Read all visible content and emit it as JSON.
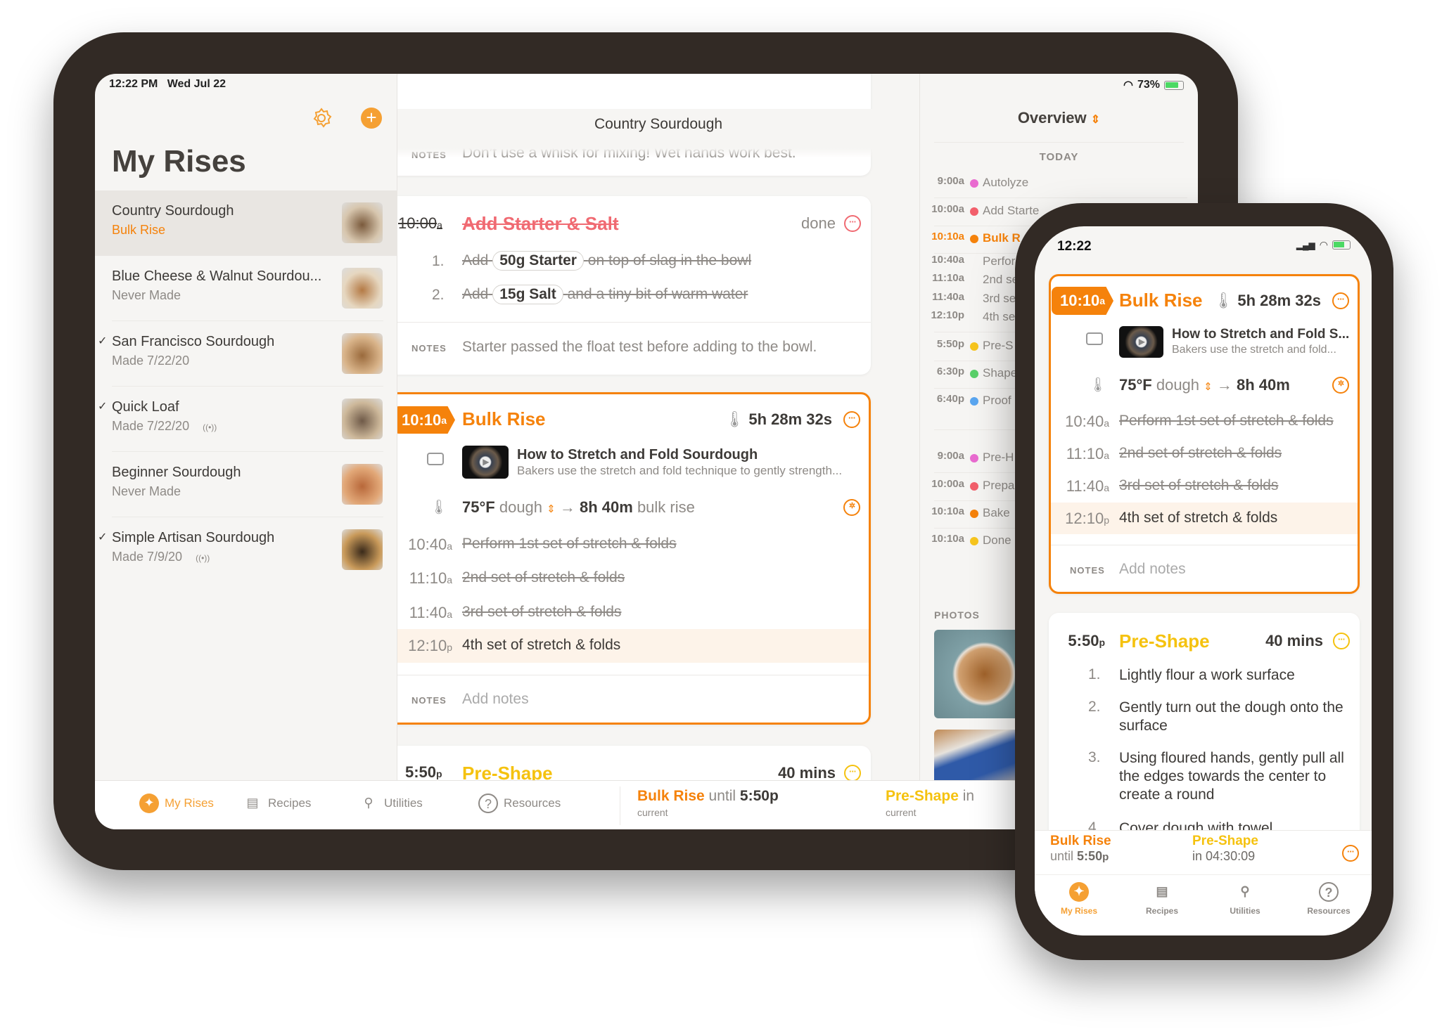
{
  "colors": {
    "accent": "#f5820b",
    "red": "#f06a72",
    "yellow": "#f5c20f",
    "bezel": "#322a25"
  },
  "ipad": {
    "status": {
      "time": "12:22 PM",
      "date": "Wed Jul 22",
      "battery": "73%"
    },
    "sidebar": {
      "title": "My Rises",
      "settings_icon": "gear-icon",
      "add_icon": "plus-circle-icon",
      "items": [
        {
          "name": "Country Sourdough",
          "subtitle": "Bulk Rise",
          "check": false,
          "shared": false,
          "selected": true,
          "thumb": [
            "#7a5a3c",
            "#d7c6ae"
          ]
        },
        {
          "name": "Blue Cheese & Walnut Sourdou...",
          "subtitle": "Never Made",
          "check": false,
          "shared": false,
          "thumb": [
            "#b47a45",
            "#e6d7c0"
          ]
        },
        {
          "name": "San Francisco Sourdough",
          "subtitle": "Made 7/22/20",
          "check": true,
          "shared": false,
          "thumb": [
            "#9a6a3c",
            "#d9b48a"
          ]
        },
        {
          "name": "Quick Loaf",
          "subtitle": "Made 7/22/20",
          "check": true,
          "shared": true,
          "thumb": [
            "#6f5a48",
            "#cdb89a"
          ]
        },
        {
          "name": "Beginner Sourdough",
          "subtitle": "Never Made",
          "check": false,
          "shared": false,
          "thumb": [
            "#b8683a",
            "#e2a878"
          ]
        },
        {
          "name": "Simple Artisan Sourdough",
          "subtitle": "Made 7/9/20",
          "check": true,
          "shared": true,
          "thumb": [
            "#3a2a1a",
            "#c99a5a"
          ]
        }
      ]
    },
    "detail": {
      "title": "Country Sourdough",
      "notes_label": "NOTES",
      "top_note": "Don’t use a whisk for mixing! Wet hands work best.",
      "add_starter": {
        "time": "10:00",
        "ampm": "a",
        "title": "Add Starter & Salt",
        "status": "done",
        "steps": [
          {
            "n": "1.",
            "pre": "Add",
            "chip": "50g Starter",
            "post": "on top of slag in the bowl"
          },
          {
            "n": "2.",
            "pre": "Add",
            "chip": "15g Salt",
            "post": "and a tiny bit of warm water"
          }
        ],
        "note": "Starter passed the float test before adding to the bowl."
      },
      "bulk": {
        "time": "10:10",
        "ampm": "a",
        "title": "Bulk Rise",
        "timer": "5h 28m 32s",
        "video_title": "How to Stretch and Fold Sourdough",
        "video_desc": "Bakers use the stretch and fold technique to gently strength...",
        "temp": "75°F",
        "temp_unit_label": "dough",
        "duration": "8h 40m",
        "duration_label": "bulk rise",
        "steps": [
          {
            "t": "10:40",
            "ap": "a",
            "text": "Perform 1st set of stretch & folds",
            "done": true
          },
          {
            "t": "11:10",
            "ap": "a",
            "text": "2nd set of stretch & folds",
            "done": true
          },
          {
            "t": "11:40",
            "ap": "a",
            "text": "3rd set of stretch & folds",
            "done": true
          },
          {
            "t": "12:10",
            "ap": "p",
            "text": "4th set of stretch & folds",
            "done": false
          }
        ],
        "note_placeholder": "Add notes"
      },
      "preshape": {
        "time": "5:50",
        "ampm": "p",
        "title": "Pre-Shape",
        "duration": "40 mins"
      }
    },
    "overview": {
      "title": "Overview",
      "section": "TODAY",
      "photos_label": "PHOTOS",
      "rows": [
        {
          "t": "9:00a",
          "label": "Autolyze",
          "dot": "#e96bd0"
        },
        {
          "t": "10:00a",
          "label": "Add Starte",
          "dot": "#f25f6b"
        },
        {
          "t": "10:10a",
          "label": "Bulk R",
          "dot": "#f5820b",
          "current": true
        },
        {
          "t": "10:40a",
          "label": "Perfor"
        },
        {
          "t": "11:10a",
          "label": "2nd se"
        },
        {
          "t": "11:40a",
          "label": "3rd se"
        },
        {
          "t": "12:10p",
          "label": "4th se"
        },
        {
          "t": "5:50p",
          "label": "Pre-S",
          "dot": "#f7c51e"
        },
        {
          "t": "6:30p",
          "label": "Shape",
          "dot": "#5ad06a"
        },
        {
          "t": "6:40p",
          "label": "Proof",
          "dot": "#5aa6f0"
        },
        {
          "t": "9:00a",
          "label": "Pre-H",
          "dot": "#e96bd0"
        },
        {
          "t": "10:00a",
          "label": "Prepa",
          "dot": "#f25f6b"
        },
        {
          "t": "10:10a",
          "label": "Bake",
          "dot": "#f5820b"
        },
        {
          "t": "10:10a",
          "label": "Done",
          "dot": "#f7c51e"
        }
      ]
    },
    "tabbar": {
      "tabs": [
        {
          "label": "My Rises",
          "icon": "sparkle-icon",
          "active": true
        },
        {
          "label": "Recipes",
          "icon": "book-icon"
        },
        {
          "label": "Utilities",
          "icon": "wand-icon"
        },
        {
          "label": "Resources",
          "icon": "question-icon"
        }
      ],
      "current": {
        "step": "Bulk Rise",
        "until": "until",
        "time": "5:50p",
        "sub": "current"
      },
      "next": {
        "step": "Pre-Shape",
        "in": "in",
        "sub": "current"
      }
    }
  },
  "phone": {
    "status": {
      "time": "12:22"
    },
    "bulk": {
      "time": "10:10",
      "ampm": "a",
      "title": "Bulk Rise",
      "timer": "5h 28m 32s",
      "video_title": "How to Stretch and Fold S...",
      "video_desc": "Bakers use the stretch and fold...",
      "temp": "75°F",
      "temp_unit_label": "dough",
      "duration": "8h 40m",
      "steps": [
        {
          "t": "10:40",
          "ap": "a",
          "text": "Perform 1st set of stretch & folds",
          "done": true
        },
        {
          "t": "11:10",
          "ap": "a",
          "text": "2nd set of stretch & folds",
          "done": true
        },
        {
          "t": "11:40",
          "ap": "a",
          "text": "3rd set of stretch & folds",
          "done": true
        },
        {
          "t": "12:10",
          "ap": "p",
          "text": "4th set of stretch & folds",
          "done": false
        }
      ],
      "notes_label": "NOTES",
      "note_placeholder": "Add notes"
    },
    "preshape": {
      "time": "5:50",
      "ampm": "p",
      "title": "Pre-Shape",
      "duration": "40 mins",
      "steps": [
        {
          "n": "1.",
          "text": "Lightly flour a work surface"
        },
        {
          "n": "2.",
          "text": "Gently turn out the dough onto the surface"
        },
        {
          "n": "3.",
          "text": "Using floured hands, gently pull all the edges towards the center to create a round"
        },
        {
          "n": "4.",
          "text": "Cover dough with towel"
        }
      ]
    },
    "bar": {
      "current": "Bulk Rise",
      "until": "until",
      "until_time": "5:50",
      "until_ampm": "p",
      "next": "Pre-Shape",
      "in": "in",
      "countdown": "04:30:09"
    },
    "tabs": [
      {
        "label": "My Rises",
        "active": true
      },
      {
        "label": "Recipes"
      },
      {
        "label": "Utilities"
      },
      {
        "label": "Resources"
      }
    ]
  }
}
